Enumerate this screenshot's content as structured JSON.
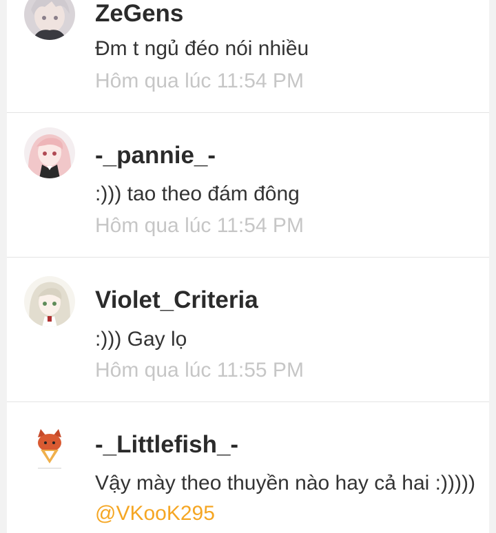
{
  "comments": [
    {
      "username": "ZeGens",
      "message": "Đm t ngủ đéo nói nhiều",
      "timestamp": "Hôm qua lúc 11:54 PM",
      "avatar_icon": "anime-avatar-white-hair-icon"
    },
    {
      "username": "-_pannie_-",
      "message": ":))) tao theo đám đông",
      "timestamp": "Hôm qua lúc 11:54 PM",
      "avatar_icon": "anime-avatar-pink-hair-icon"
    },
    {
      "username": "Violet_Criteria",
      "message": ":))) Gay lọ",
      "timestamp": "Hôm qua lúc 11:55 PM",
      "avatar_icon": "anime-avatar-silver-hair-icon"
    },
    {
      "username": "-_Littlefish_-",
      "message": "Vậy mày theo thuyền nào hay cả hai :)))))",
      "mention": "@VKooK295",
      "avatar_icon": "fox-mascot-avatar-icon"
    }
  ],
  "colors": {
    "username": "#2b2b2b",
    "timestamp": "#c6c6c6",
    "mention": "#f5a623",
    "background": "#f2f2f2",
    "card": "#ffffff"
  }
}
